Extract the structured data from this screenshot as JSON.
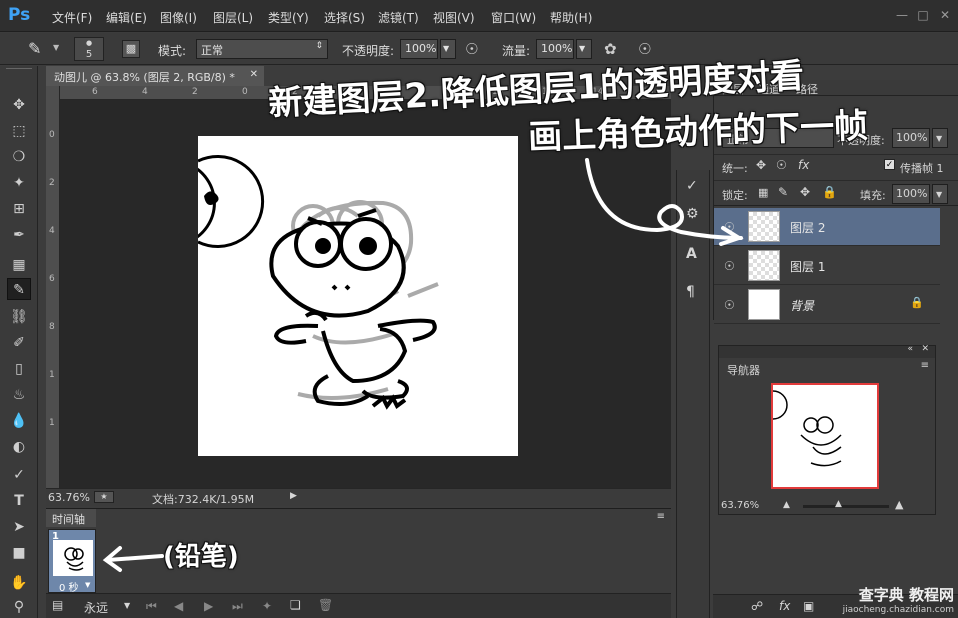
{
  "app": {
    "logo": "Ps"
  },
  "menubar": {
    "items": [
      "文件(F)",
      "编辑(E)",
      "图像(I)",
      "图层(L)",
      "类型(Y)",
      "选择(S)",
      "滤镜(T)",
      "视图(V)",
      "窗口(W)",
      "帮助(H)"
    ]
  },
  "options": {
    "brush_size": "5",
    "mode_label": "模式:",
    "mode_value": "正常",
    "opacity_label": "不透明度:",
    "opacity_value": "100%",
    "flow_label": "流量:",
    "flow_value": "100%"
  },
  "document": {
    "tab_title": "动图儿 @ 63.8% (图层 2, RGB/8) *",
    "ruler_ticks": [
      "6",
      "4",
      "2",
      "0",
      "2",
      "4",
      "6",
      "8",
      "10",
      "12",
      "14",
      "16"
    ],
    "left_ruler_ticks": [
      "0",
      "2",
      "4",
      "6",
      "8",
      "1",
      "1"
    ],
    "zoom": "63.76%",
    "doc_size": "文档:732.4K/1.95M"
  },
  "timeline": {
    "tab_label": "时间轴",
    "frame_number": "1",
    "frame_delay": "0 秒",
    "loop_value": "永远"
  },
  "layers_panel": {
    "tabs": [
      "图层",
      "通道",
      "路径"
    ],
    "blend_value": "正常",
    "opacity_label": "不透明度:",
    "opacity_value": "100%",
    "unify_label": "统一:",
    "propagate_label": "传播帧 1",
    "lock_label": "锁定:",
    "fill_label": "填充:",
    "fill_value": "100%",
    "layers": [
      {
        "name": "图层 2",
        "selected": true
      },
      {
        "name": "图层 1",
        "selected": false
      },
      {
        "name": "背景",
        "selected": false
      }
    ]
  },
  "navigator": {
    "tab_label": "导航器",
    "zoom": "63.76%"
  },
  "annotations": {
    "line1": "新建图层2.降低图层1的透明度对看",
    "line2": "画上角色动作的下一帧",
    "pen_note": "(铅笔)"
  },
  "watermark": {
    "main": "查字典 教程网",
    "url": "jiaocheng.chazidian.com"
  },
  "colors": {
    "accent_blue": "#3fa3f6",
    "selected_layer": "#5a6e8c",
    "nav_frame": "#e23b3b"
  }
}
